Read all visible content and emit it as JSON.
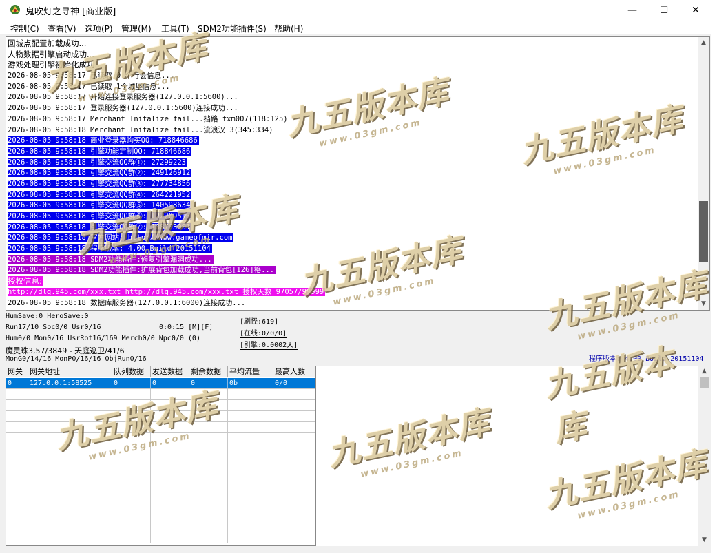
{
  "window": {
    "title": "鬼吹灯之寻神 [商业版]",
    "minimize": "—",
    "maximize": "☐",
    "close": "✕"
  },
  "menu": [
    "控制(C)",
    "查看(V)",
    "选项(P)",
    "管理(M)",
    "工具(T)",
    "SDM2功能插件(S)",
    "帮助(H)"
  ],
  "log": [
    {
      "text": "回城点配置加载成功...",
      "style": "plain"
    },
    {
      "text": "人物数据引擎启动成功...",
      "style": "plain"
    },
    {
      "text": "游戏处理引擎初始化成功...",
      "style": "plain"
    },
    {
      "text": "2026-08-05 9:58:17 已读取 0 个行会信息...",
      "style": "plain"
    },
    {
      "text": "2026-08-05 9:58:17 已读取 1个城堡信息...",
      "style": "plain"
    },
    {
      "text": "2026-08-05 9:58:17 开始连接登录服务器(127.0.0.1:5600)...",
      "style": "plain"
    },
    {
      "text": "2026-08-05 9:58:17 登录服务器(127.0.0.1:5600)连接成功...",
      "style": "plain"
    },
    {
      "text": "2026-08-05 9:58:17 Merchant Initalize fail...挡路 fxm007(118:125)",
      "style": "plain"
    },
    {
      "text": "2026-08-05 9:58:18 Merchant Initalize fail...流浪汉 3(345:334)",
      "style": "plain"
    },
    {
      "text": "2026-08-05 9:58:18 商业登录器购买QQ: 718846686",
      "style": "blue"
    },
    {
      "text": "2026-08-05 9:58:18 引擎功能定制QQ: 718846686",
      "style": "blue"
    },
    {
      "text": "2026-08-05 9:58:18 引擎交流QQ群①: 27299223",
      "style": "blue"
    },
    {
      "text": "2026-08-05 9:58:18 引擎交流QQ群②: 249126912",
      "style": "blue"
    },
    {
      "text": "2026-08-05 9:58:18 引擎交流QQ群③: 277734856",
      "style": "blue"
    },
    {
      "text": "2026-08-05 9:58:18 引擎交流QQ群④: 264221952",
      "style": "blue"
    },
    {
      "text": "2026-08-05 9:58:18 引擎交流QQ群⑤: 140598634",
      "style": "blue"
    },
    {
      "text": "2026-08-05 9:58:18 引擎交流QQ群⑥: 122209510",
      "style": "blue"
    },
    {
      "text": "2026-08-05 9:58:18 引擎交流QQ群⑦: 188703001",
      "style": "blue"
    },
    {
      "text": "2026-08-05 9:58:18 官方网站: http://www.gameofmir.com",
      "style": "blue"
    },
    {
      "text": "2026-08-05 9:58:18 程序版本: 4.00 Build 20151104",
      "style": "blue"
    },
    {
      "text": "2026-08-05 9:58:18 SDM2功能插件:修复引擎漏洞成功...",
      "style": "purple"
    },
    {
      "text": "2026-08-05 9:58:18 SDM2功能插件:扩展背包加载成功,当前背包[126]格...",
      "style": "purple"
    },
    {
      "text": "授权信息:",
      "style": "magenta"
    },
    {
      "text": "http://dlq.945.com/xxx.txt http://dlq.945.com/xxx.txt 授权天数 97057/99999",
      "style": "magenta"
    },
    {
      "text": "2026-08-05 9:58:18 数据库服务器(127.0.0.1:6000)连接成功...",
      "style": "plain"
    }
  ],
  "status": {
    "line1": "HumSave:0 HeroSave:0",
    "line2": "Run17/10 Soc0/0 Usr0/16",
    "timer": "0:0:15 [M][F]",
    "line3": "Hum0/0 Mon0/16 UsrRot16/169 Merch0/0 Npc0/0 (0)",
    "line4": "魔灵珠3,57/3849 - 天庭巡卫/41/6",
    "line5": "MonG0/14/16 MonP0/16/16 ObjRun0/16",
    "refresh": "[刷怪:619]",
    "online": "[在线:0/0/0]",
    "engine": "[引擎:0.0002天]",
    "version": "程序版本: 4.00 Build 20151104"
  },
  "grid": {
    "headers": [
      "网关",
      "网关地址",
      "队列数据",
      "发送数据",
      "剩余数据",
      "平均流量",
      "最高人数"
    ],
    "rows": [
      [
        "0",
        "127.0.0.1:58525",
        "0",
        "0",
        "0",
        "0b",
        "0/0"
      ]
    ]
  },
  "watermark": {
    "main": "九五版本库",
    "sub": "www.03gm.com"
  }
}
